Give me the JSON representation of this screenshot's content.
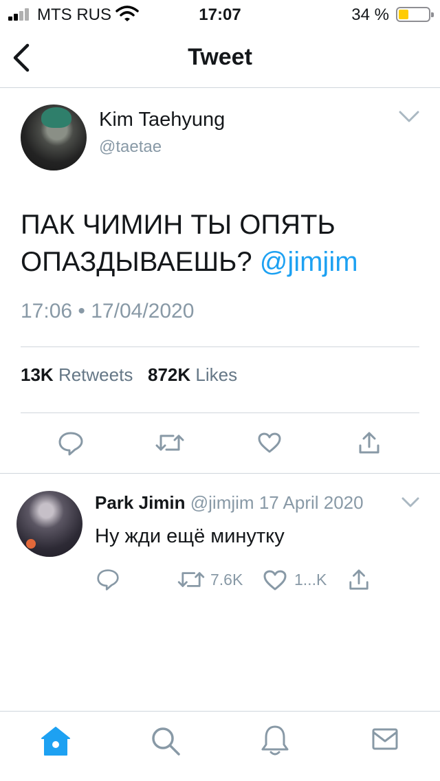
{
  "status_bar": {
    "carrier": "MTS RUS",
    "time": "17:07",
    "battery_percent": "34 %",
    "battery_level": 0.34,
    "battery_color": "#ffcc00"
  },
  "nav": {
    "back_icon": "chevron-left-icon",
    "title": "Tweet"
  },
  "tweet": {
    "author_name": "Kim Taehyung",
    "author_handle": "@taetae",
    "text": "ПАК ЧИМИН ТЫ ОПЯТЬ ОПАЗДЫВАЕШЬ? ",
    "mention": "@jimjim",
    "timestamp": "17:06 • 17/04/2020",
    "retweets_count": "13K",
    "retweets_label": "Retweets",
    "likes_count": "872K",
    "likes_label": "Likes",
    "actions": [
      "reply-icon",
      "retweet-icon",
      "like-icon",
      "share-icon"
    ]
  },
  "reply": {
    "author_name": "Park Jimin",
    "author_handle": "@jimjim",
    "date": "17 April 2020",
    "text": "Ну жди ещё минутку",
    "retweet_count": "7.6K",
    "like_count": "1...K"
  },
  "tab_bar": {
    "items": [
      "home-icon",
      "search-icon",
      "notifications-icon",
      "messages-icon"
    ],
    "active": "home-icon"
  },
  "colors": {
    "accent": "#1da1f2",
    "secondary_text": "#8899a6",
    "divider": "#cfd6dc",
    "icon": "#657786"
  }
}
